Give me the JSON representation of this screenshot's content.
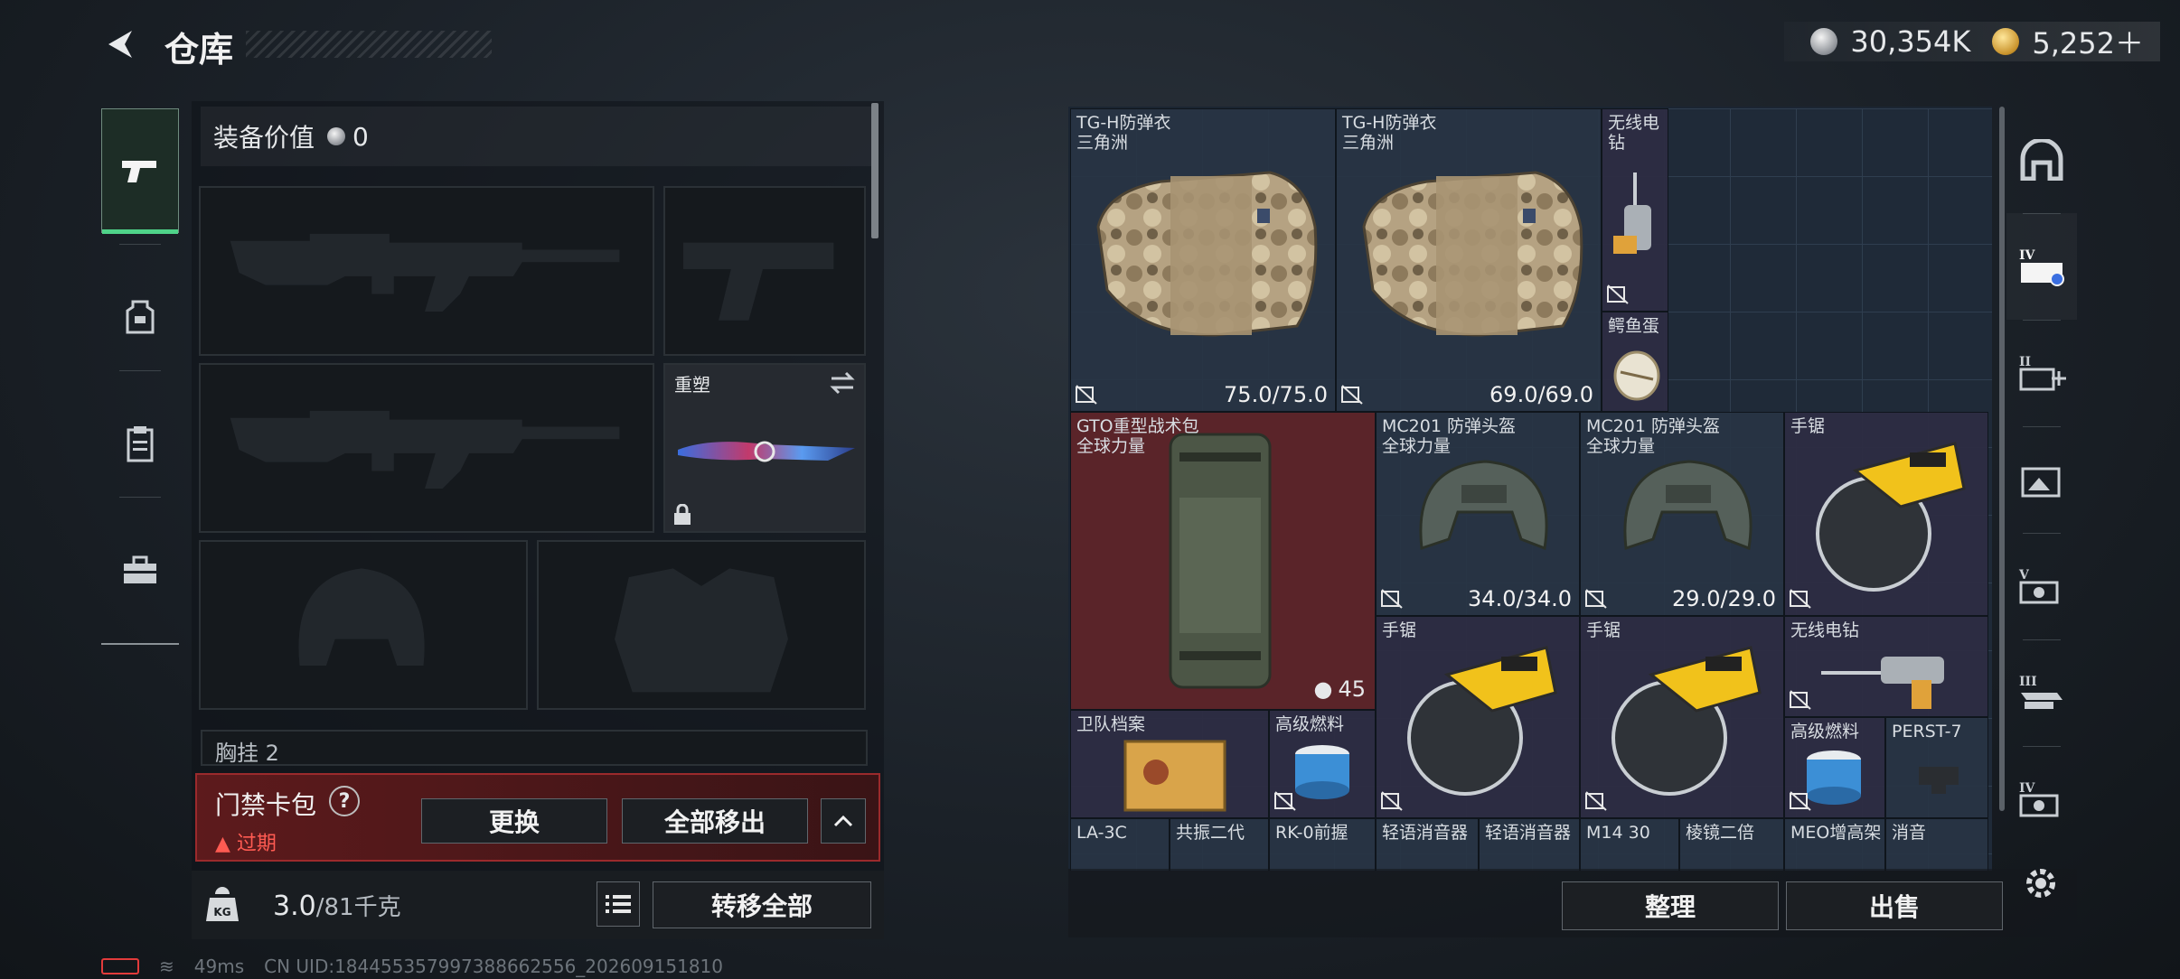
{
  "header": {
    "title": "仓库"
  },
  "currency": {
    "primary": "30,354K",
    "secondary": "5,252＋"
  },
  "left_nav": [
    {
      "name": "weapons",
      "icon": "pistol-icon",
      "active": true
    },
    {
      "name": "armor",
      "icon": "backpack-icon",
      "active": false
    },
    {
      "name": "rig",
      "icon": "clipboard-icon",
      "active": false
    },
    {
      "name": "case",
      "icon": "toolbox-icon",
      "active": false
    }
  ],
  "equipment": {
    "value_label": "装备价值",
    "value": "0",
    "knife_label": "重塑",
    "chest_row_label": "胸挂 2"
  },
  "access_card": {
    "title": "门禁卡包",
    "help": "?",
    "status": "过期",
    "replace_button": "更换",
    "move_all_button": "全部移出"
  },
  "weight": {
    "current": "3.0",
    "max": "/81千克",
    "transfer_button": "转移全部"
  },
  "status_bar": {
    "ping": "49ms",
    "uid": "CN UID:18445535799738866​2556_202609151810"
  },
  "stash": {
    "items": [
      {
        "id": "vest1",
        "name": "TG-H防弹衣\n三角洲",
        "durability": "75.0/75.0"
      },
      {
        "id": "vest2",
        "name": "TG-H防弹衣\n三角洲",
        "durability": "69.0/69.0"
      },
      {
        "id": "drill1",
        "name": "无线电钻"
      },
      {
        "id": "egg",
        "name": "鳄鱼蛋"
      },
      {
        "id": "bag",
        "name": "GTO重型战术包\n全球力量",
        "count": "45"
      },
      {
        "id": "helm1",
        "name": "MC201 防弹头盔\n全球力量",
        "durability": "34.0/34.0"
      },
      {
        "id": "helm2",
        "name": "MC201 防弹头盔\n全球力量",
        "durability": "29.0/29.0"
      },
      {
        "id": "saw1",
        "name": "手锯"
      },
      {
        "id": "saw2",
        "name": "手锯"
      },
      {
        "id": "saw3",
        "name": "手锯"
      },
      {
        "id": "drill2",
        "name": "无线电钻"
      },
      {
        "id": "docs",
        "name": "卫队档案"
      },
      {
        "id": "fuel1",
        "name": "高级燃料"
      },
      {
        "id": "fuel2",
        "name": "高级燃料"
      },
      {
        "id": "perst",
        "name": "PERST-7"
      },
      {
        "id": "la3c",
        "name": "LA-3C"
      },
      {
        "id": "gongzhen",
        "name": "共振二代"
      },
      {
        "id": "rk0",
        "name": "RK-0前握"
      },
      {
        "id": "supp1",
        "name": "轻语消音器"
      },
      {
        "id": "supp2",
        "name": "轻语消音器"
      },
      {
        "id": "m1430",
        "name": "M14 30"
      },
      {
        "id": "prism",
        "name": "棱镜二倍"
      },
      {
        "id": "meo",
        "name": "MEO增高架"
      },
      {
        "id": "xiaoyin",
        "name": "消音"
      }
    ],
    "sort_button": "整理",
    "sell_button": "出售"
  },
  "right_nav": [
    {
      "name": "all-items",
      "icon": "home-arch-icon"
    },
    {
      "name": "stash-iv",
      "icon": "stash-iv-icon"
    },
    {
      "name": "stash-ii",
      "icon": "stash-add-icon"
    },
    {
      "name": "stash-photo",
      "icon": "image-tab-icon"
    },
    {
      "name": "stash-v",
      "icon": "stash-v-icon"
    },
    {
      "name": "stash-iii",
      "icon": "stash-iii-icon"
    },
    {
      "name": "stash-iv-b",
      "icon": "stash-iv-b-icon"
    }
  ],
  "colors": {
    "accent_green": "#4fd389",
    "alert_red": "#ff5b52",
    "card_border": "#9b2a2c",
    "stash_bg": "#1f2a38",
    "bag_bg": "#5a2429"
  }
}
